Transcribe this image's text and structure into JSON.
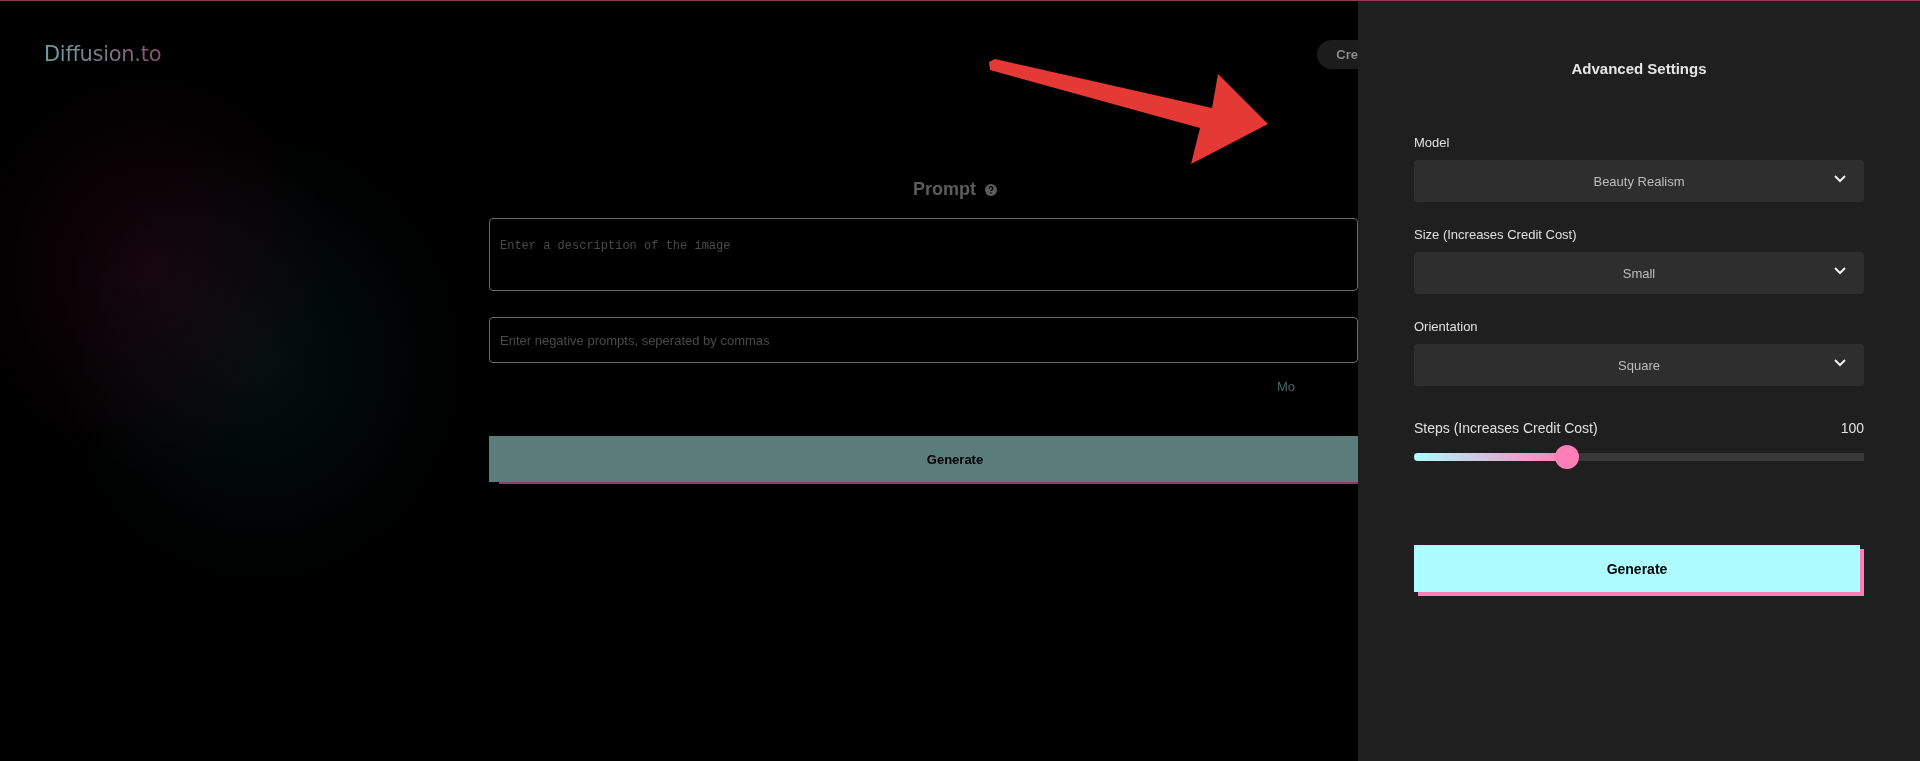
{
  "header": {
    "logo": "Diffusion.to",
    "button": "Cre"
  },
  "prompt": {
    "title": "Prompt",
    "description_placeholder": "Enter a description of the image",
    "negative_placeholder": "Enter negative prompts, seperated by commas",
    "link": "Mo",
    "generate": "Generate"
  },
  "panel": {
    "title": "Advanced Settings",
    "selects": [
      {
        "label": "Model",
        "value": "Beauty Realism"
      },
      {
        "label": "Size (Increases Credit Cost)",
        "value": "Small"
      },
      {
        "label": "Orientation",
        "value": "Square"
      }
    ],
    "steps": {
      "label": "Steps (Increases Credit Cost)",
      "reading": "100",
      "level": 0.34
    },
    "generate": "Generate"
  }
}
